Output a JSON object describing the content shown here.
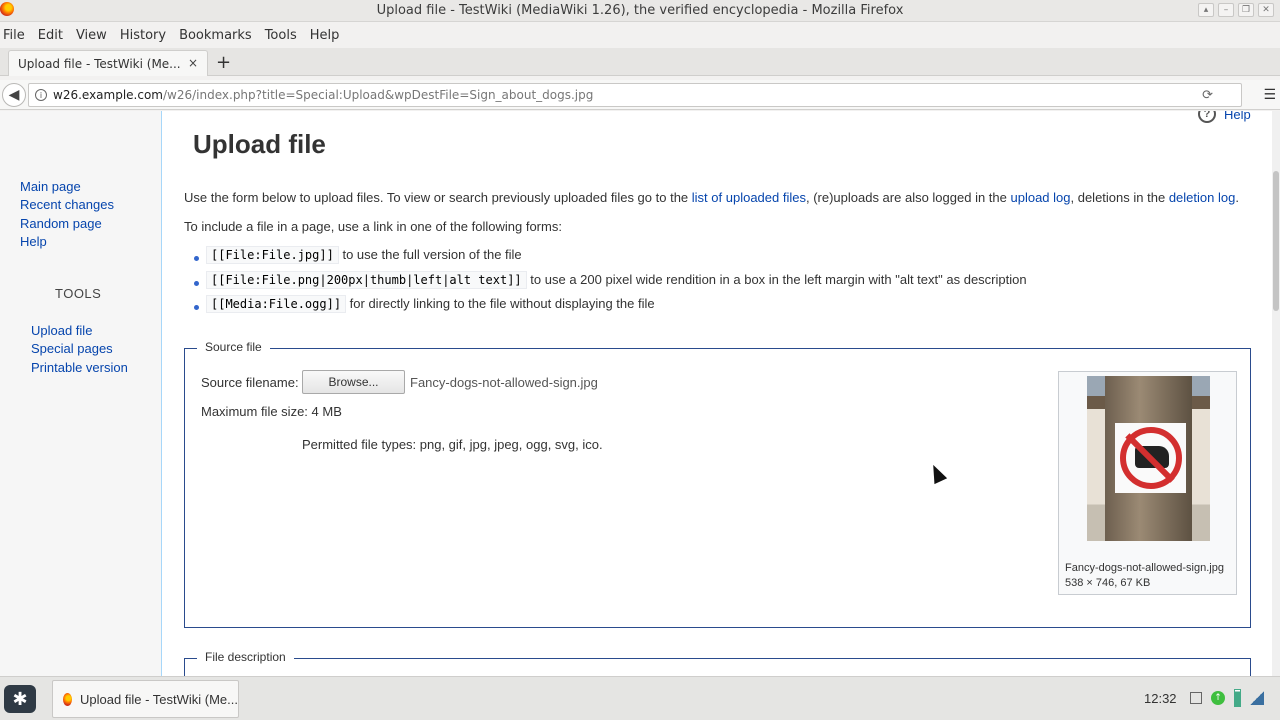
{
  "window": {
    "title": "Upload file - TestWiki (MediaWiki 1.26), the verified encyclopedia - Mozilla Firefox"
  },
  "menubar": [
    "File",
    "Edit",
    "View",
    "History",
    "Bookmarks",
    "Tools",
    "Help"
  ],
  "tab": {
    "title": "Upload file - TestWiki (Me...",
    "close": "×",
    "new_tab": "+"
  },
  "navbar": {
    "url_domain": "w26.example.com",
    "url_path": "/w26/index.php?title=Special:Upload&wpDestFile=Sign_about_dogs.jpg"
  },
  "sidebar": {
    "nav": [
      "Main page",
      "Recent changes",
      "Random page",
      "Help"
    ],
    "tools_heading": "TOOLS",
    "tools": [
      "Upload file",
      "Special pages",
      "Printable version"
    ]
  },
  "help_link": "Help",
  "page": {
    "title": "Upload file",
    "intro_a": "Use the form below to upload files. To view or search previously uploaded files go to the",
    "link_uploaded": "list of uploaded files",
    "intro_b": ", (re)uploads are also logged in the",
    "link_upload_log": "upload log",
    "intro_c": ", deletions in the",
    "link_deletion_log": "deletion log",
    "intro_d": ".",
    "include_text": "To include a file in a page, use a link in one of the following forms:",
    "forms": [
      {
        "code": "[[File:File.jpg]]",
        "desc": "to use the full version of the file"
      },
      {
        "code": "[[File:File.png|200px|thumb|left|alt text]]",
        "desc": "to use a 200 pixel wide rendition in a box in the left margin with \"alt text\" as description"
      },
      {
        "code": "[[Media:File.ogg]]",
        "desc": "for directly linking to the file without displaying the file"
      }
    ]
  },
  "source_file": {
    "legend": "Source file",
    "filename_label": "Source filename:",
    "browse_label": "Browse...",
    "selected_file": "Fancy-dogs-not-allowed-sign.jpg",
    "max_size": "Maximum file size: 4 MB",
    "permitted": "Permitted file types: png, gif, jpg, jpeg, ogg, svg, ico.",
    "thumb_caption": "Fancy-dogs-not-allowed-sign.jpg",
    "thumb_info": "538 × 746, 67 KB"
  },
  "file_description": {
    "legend": "File description"
  },
  "taskbar": {
    "item": "Upload file - TestWiki (Me...",
    "clock": "12:32"
  }
}
